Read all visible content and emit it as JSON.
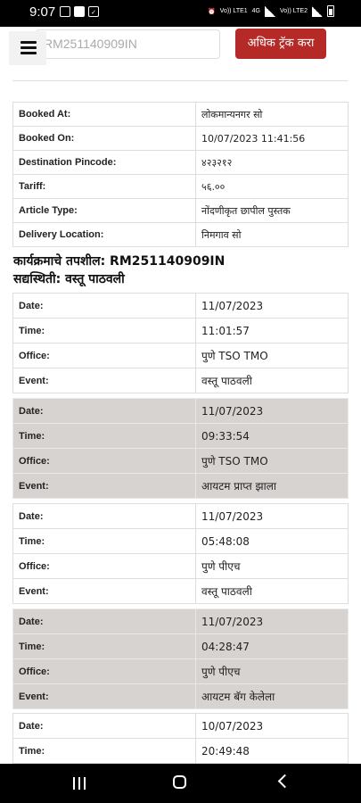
{
  "status_bar": {
    "time": "9:07",
    "network_1": "Vo)) LTE1",
    "network_2": "4G",
    "network_3": "Vo)) LTE2"
  },
  "header": {
    "search_value": "RM251140909IN",
    "track_more_button": "अधिक ट्रॅक करा"
  },
  "booking_info": [
    {
      "label": "Booked At:",
      "value": "लोकमान्यनगर सो"
    },
    {
      "label": "Booked On:",
      "value": "10/07/2023 11:41:56"
    },
    {
      "label": "Destination Pincode:",
      "value": "४२३२१२"
    },
    {
      "label": "Tariff:",
      "value": "५६.००"
    },
    {
      "label": "Article Type:",
      "value": "नोंदणीकृत छापील पुस्तक"
    },
    {
      "label": "Delivery Location:",
      "value": "निमगाव सो"
    }
  ],
  "tracking_heading": "कार्यक्रमाचे तपशील: RM251140909IN",
  "status_heading": "सद्यस्थिती: वस्तू पाठवली",
  "events": [
    {
      "date": "11/07/2023",
      "time": "11:01:57",
      "office": "पुणे TSO TMO",
      "event": "वस्तू पाठवली"
    },
    {
      "date": "11/07/2023",
      "time": "09:33:54",
      "office": "पुणे TSO TMO",
      "event": "आयटम प्राप्त झाला"
    },
    {
      "date": "11/07/2023",
      "time": "05:48:08",
      "office": "पुणे पीएच",
      "event": "वस्तू पाठवली"
    },
    {
      "date": "11/07/2023",
      "time": "04:28:47",
      "office": "पुणे पीएच",
      "event": "आयटम बॅग केलेला"
    },
    {
      "date": "10/07/2023",
      "time": "20:49:48"
    }
  ],
  "event_labels": {
    "date": "Date:",
    "time": "Time:",
    "office": "Office:",
    "event": "Event:"
  }
}
